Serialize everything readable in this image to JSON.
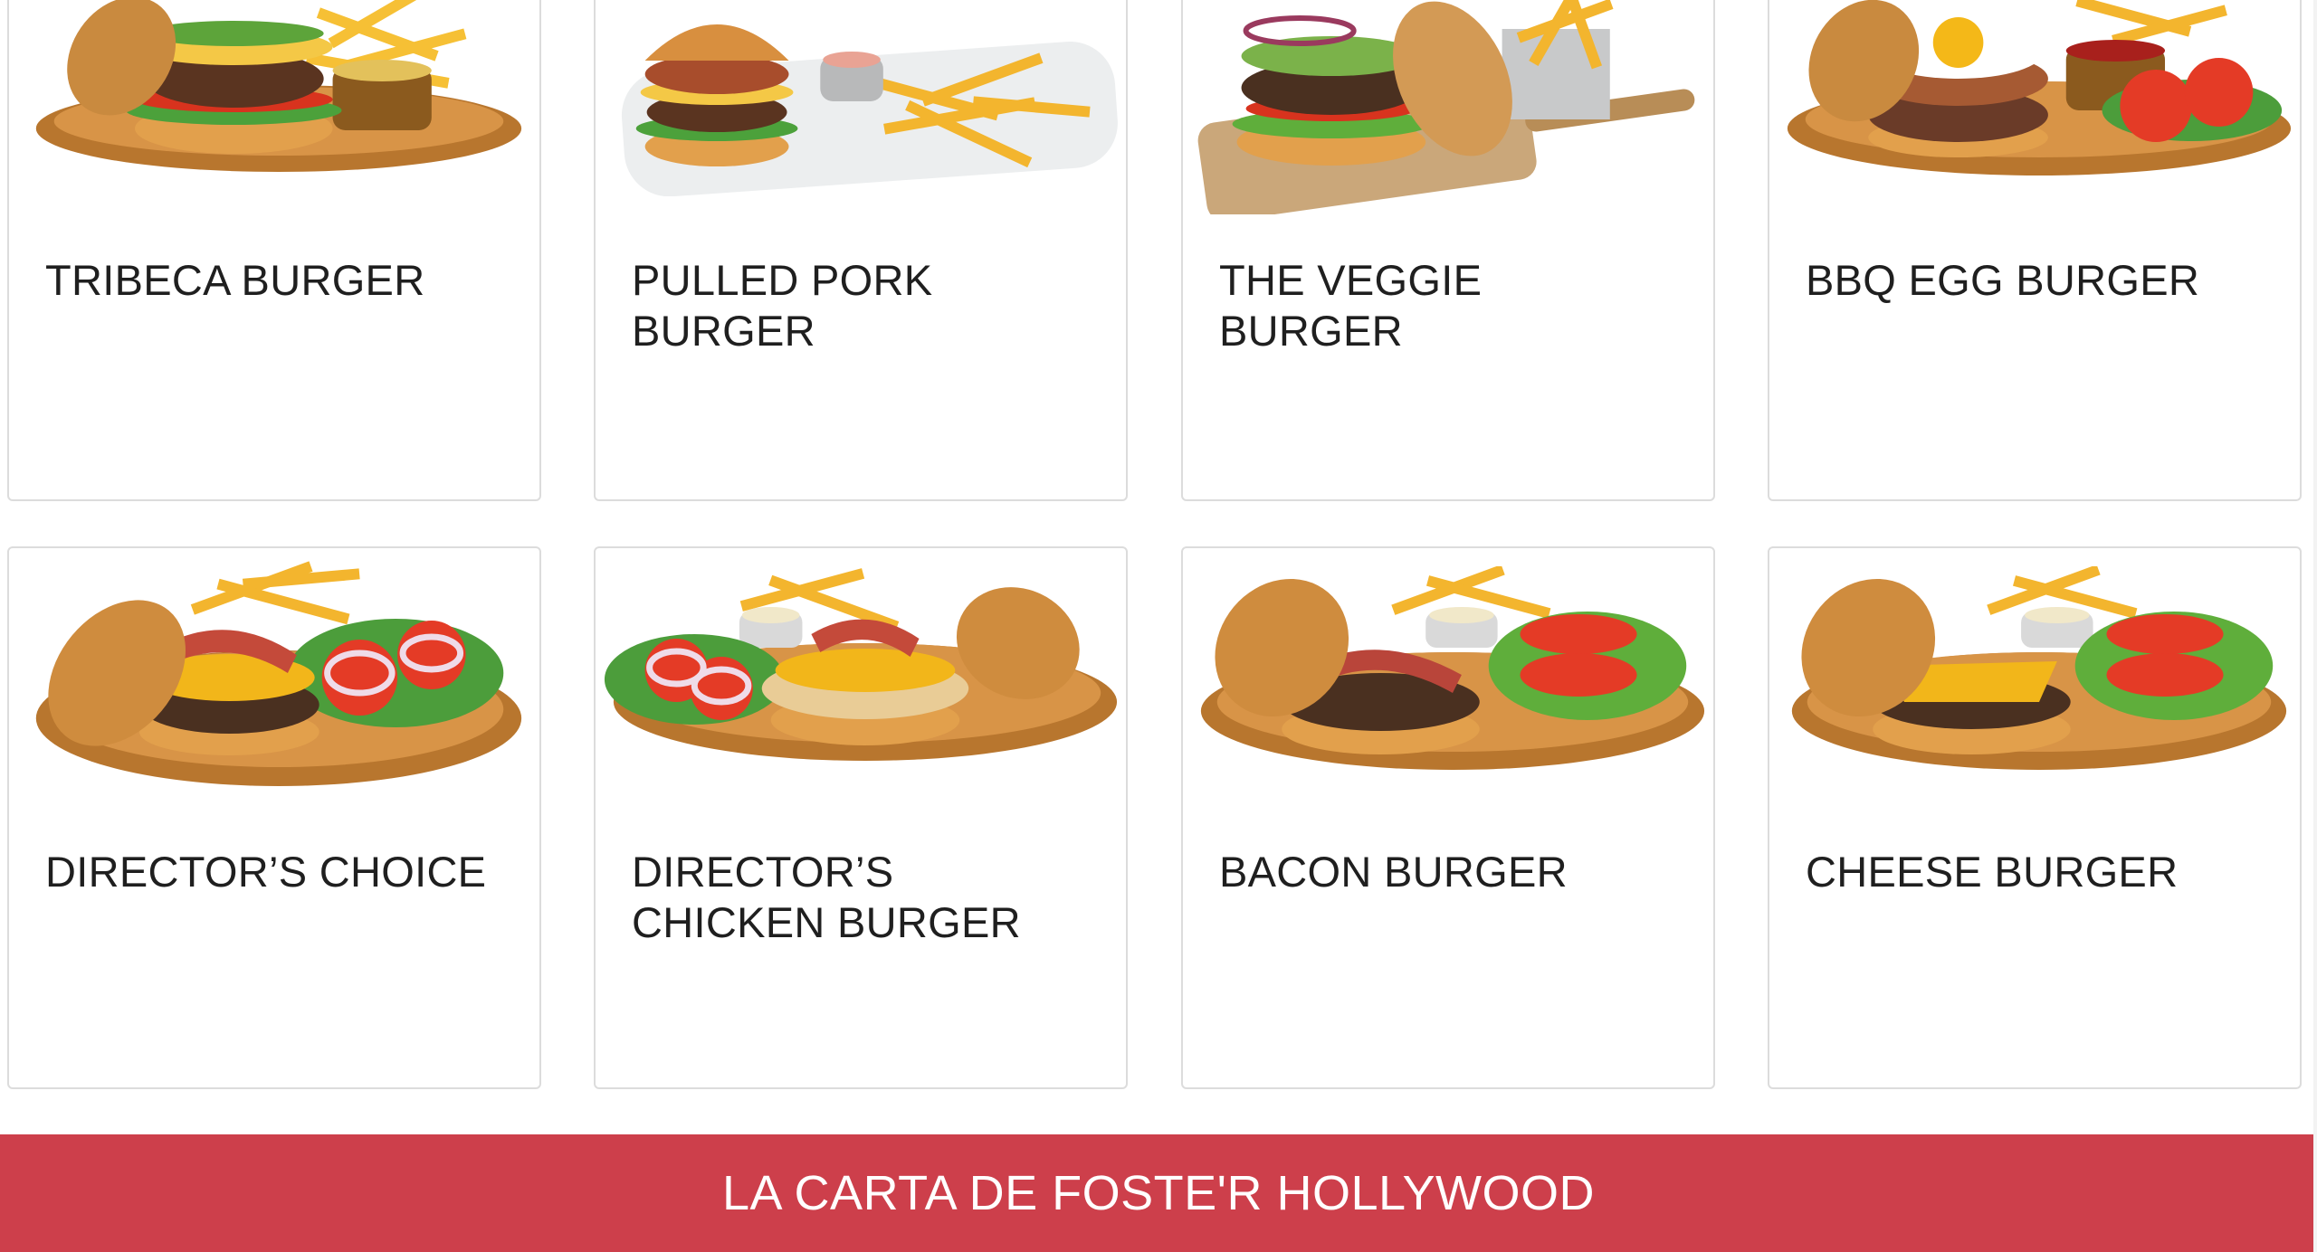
{
  "menu": {
    "items": [
      {
        "name": "TRIBECA BURGER",
        "image": "tribeca-burger-image"
      },
      {
        "name": "PULLED PORK BURGER",
        "image": "pulled-pork-burger-image"
      },
      {
        "name": "THE VEGGIE BURGER",
        "image": "veggie-burger-image"
      },
      {
        "name": "BBQ EGG BURGER",
        "image": "bbq-egg-burger-image"
      },
      {
        "name": "DIRECTOR’S CHOICE",
        "image": "directors-choice-image"
      },
      {
        "name": "DIRECTOR’S CHICKEN BURGER",
        "image": "directors-chicken-burger-image"
      },
      {
        "name": "BACON BURGER",
        "image": "bacon-burger-image"
      },
      {
        "name": "CHEESE BURGER",
        "image": "cheese-burger-image"
      }
    ]
  },
  "banner": {
    "label": "LA CARTA DE FOSTE'R HOLLYWOOD"
  },
  "colors": {
    "banner_bg": "#cd3f4b",
    "card_border": "#dcdcdc",
    "title_text": "#1f1f1f"
  }
}
